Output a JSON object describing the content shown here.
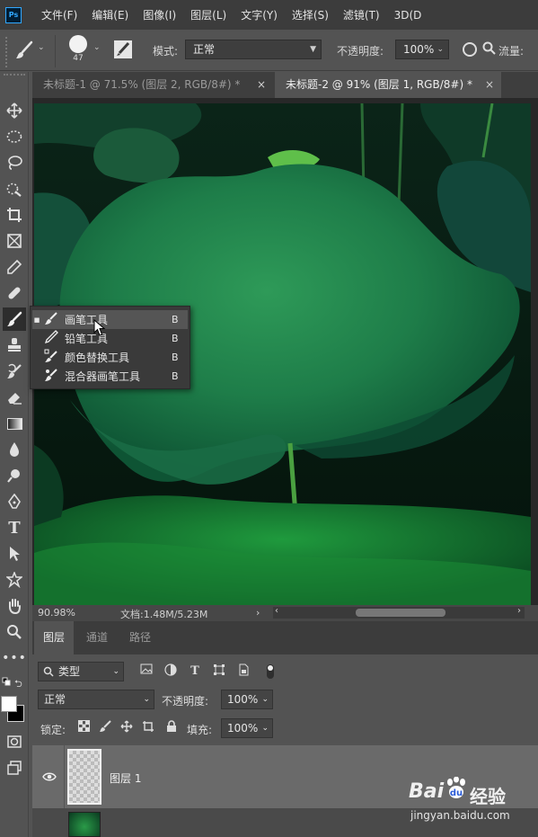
{
  "app": {
    "logo_text": "Ps",
    "menu": [
      "文件(F)",
      "编辑(E)",
      "图像(I)",
      "图层(L)",
      "文字(Y)",
      "选择(S)",
      "滤镜(T)",
      "3D(D"
    ]
  },
  "options_bar": {
    "brush_size": "47",
    "mode_label": "模式:",
    "mode_value": "正常",
    "opacity_label": "不透明度:",
    "opacity_value": "100%",
    "flow_label": "流量:"
  },
  "tabs": [
    {
      "label": "未标题-1 @ 71.5% (图层 2, RGB/8#) *",
      "active": false
    },
    {
      "label": "未标题-2 @ 91% (图层 1, RGB/8#) *",
      "active": true
    }
  ],
  "tabs_close_glyph": "×",
  "statusbar": {
    "zoom": "90.98%",
    "doc_info": "文档:1.48M/5.23M"
  },
  "brush_flyout": {
    "items": [
      {
        "label": "画笔工具",
        "key": "B",
        "selected": true,
        "icon": "brush-icon"
      },
      {
        "label": "铅笔工具",
        "key": "B",
        "selected": false,
        "icon": "pencil-icon"
      },
      {
        "label": "颜色替换工具",
        "key": "B",
        "selected": false,
        "icon": "color-replace-icon"
      },
      {
        "label": "混合器画笔工具",
        "key": "B",
        "selected": false,
        "icon": "mixer-brush-icon"
      }
    ]
  },
  "layers_panel": {
    "tabs": [
      {
        "label": "图层",
        "active": true
      },
      {
        "label": "通道",
        "active": false
      },
      {
        "label": "路径",
        "active": false
      }
    ],
    "filter_label": "类型",
    "blend_mode": "正常",
    "opacity_label": "不透明度:",
    "opacity_value": "100%",
    "lock_label": "锁定:",
    "fill_label": "填充:",
    "fill_value": "100%",
    "layers": [
      {
        "name": "图层 1",
        "visible": true
      }
    ]
  },
  "watermark": {
    "brand": "Bai",
    "brand_suffix": "经验",
    "url": "jingyan.baidu.com"
  }
}
